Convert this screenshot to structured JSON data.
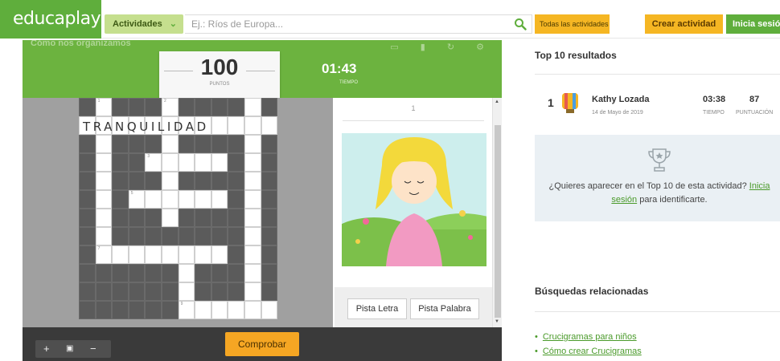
{
  "header": {
    "logo": "educaplay",
    "activities_label": "Actividades",
    "search_placeholder": "Ej.: Ríos de Europa...",
    "all_activities_label": "Todas las actividades",
    "create_label": "Crear actividad",
    "login_label": "Inicia sesión"
  },
  "game": {
    "title": "Cómo nos organizamos",
    "points": "100",
    "points_label": "PUNTOS",
    "time": "01:43",
    "time_label": "TIEMPO",
    "crossword_word": "TRANQUILIDAD",
    "clue_number": "1",
    "hint_letter_label": "Pista Letra",
    "hint_word_label": "Pista Palabra",
    "check_label": "Comprobar",
    "zoom_in": "+",
    "zoom_fit": "▣",
    "zoom_out": "−"
  },
  "top10": {
    "title": "Top 10 resultados",
    "entries": [
      {
        "rank": "1",
        "name": "Kathy Lozada",
        "date": "14 de Mayo de 2019",
        "time": "03:38",
        "time_label": "TIEMPO",
        "score": "87",
        "score_label": "PUNTUACIÓN"
      }
    ],
    "invite_text": "¿Quieres aparecer en el Top 10 de esta actividad?",
    "invite_link_1": "Inicia",
    "invite_link_2": "sesión",
    "invite_suffix": "para identificarte."
  },
  "related": {
    "title": "Búsquedas relacionadas",
    "items": [
      "Crucigramas para niños",
      "Cómo crear Crucigramas"
    ]
  },
  "colors": {
    "brand_green": "#6cb33f",
    "accent_orange": "#f5a623",
    "link_green": "#4a9a2a"
  }
}
